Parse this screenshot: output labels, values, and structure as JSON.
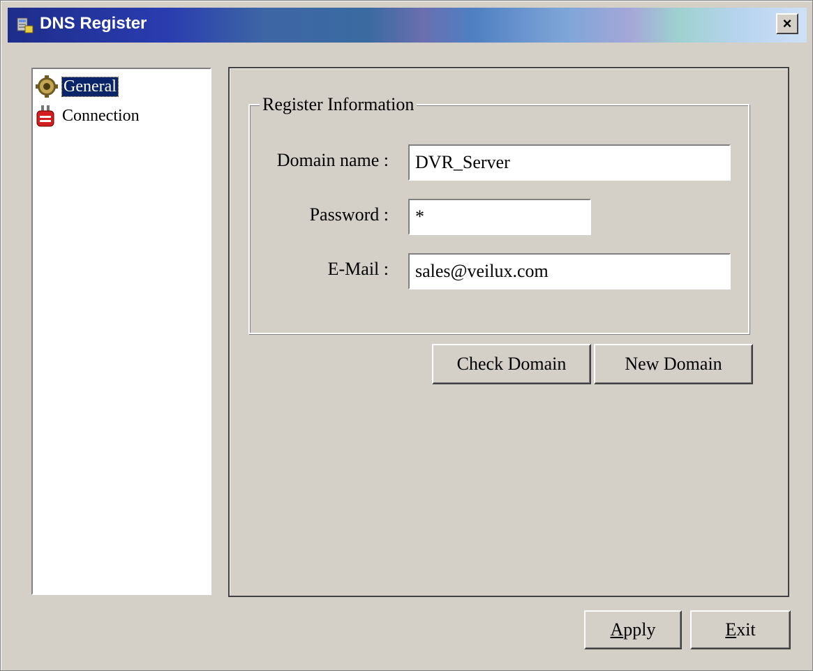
{
  "window": {
    "title": "DNS Register",
    "close_label": "×"
  },
  "tree": {
    "items": [
      {
        "label": "General",
        "icon": "gear-icon",
        "selected": true
      },
      {
        "label": "Connection",
        "icon": "plug-icon",
        "selected": false
      }
    ]
  },
  "register": {
    "group_title": "Register Information",
    "domain_label": "Domain name :",
    "domain_value": "DVR_Server",
    "password_label": "Password :",
    "password_value": "*",
    "email_label": "E-Mail :",
    "email_value": "sales@veilux.com"
  },
  "buttons": {
    "check_domain": "Check Domain",
    "new_domain": "New Domain",
    "apply_mnemonic": "A",
    "apply_rest": "pply",
    "exit_mnemonic": "E",
    "exit_rest": "xit"
  }
}
